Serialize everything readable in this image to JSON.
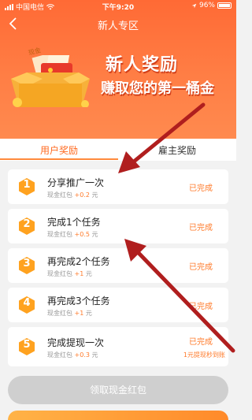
{
  "status_bar": {
    "carrier": "中国电信",
    "time": "下午9:20",
    "battery": "96%"
  },
  "nav": {
    "title": "新人专区"
  },
  "banner": {
    "title": "新人奖励",
    "subtitle": "赚取您的第一桶金",
    "box_label": "现金"
  },
  "tabs": [
    {
      "label": "用户奖励",
      "active": true
    },
    {
      "label": "雇主奖励",
      "active": false
    }
  ],
  "tasks": [
    {
      "num": "1",
      "title": "分享推广一次",
      "reward_label": "现金红包",
      "amount": "+0.2",
      "unit": "元",
      "status": "已完成",
      "note": ""
    },
    {
      "num": "2",
      "title": "完成1个任务",
      "reward_label": "现金红包",
      "amount": "+0.5",
      "unit": "元",
      "status": "已完成",
      "note": ""
    },
    {
      "num": "3",
      "title": "再完成2个任务",
      "reward_label": "现金红包",
      "amount": "+1",
      "unit": "元",
      "status": "已完成",
      "note": ""
    },
    {
      "num": "4",
      "title": "再完成3个任务",
      "reward_label": "现金红包",
      "amount": "+1",
      "unit": "元",
      "status": "已完成",
      "note": ""
    },
    {
      "num": "5",
      "title": "完成提现一次",
      "reward_label": "现金红包",
      "amount": "+0.3",
      "unit": "元",
      "status": "已完成",
      "note": "1元提现秒到账"
    }
  ],
  "claim_button": {
    "label": "领取现金红包"
  },
  "colors": {
    "accent": "#ff7a2a",
    "hex": "#ffa21f",
    "arrow": "#b01e1e"
  }
}
